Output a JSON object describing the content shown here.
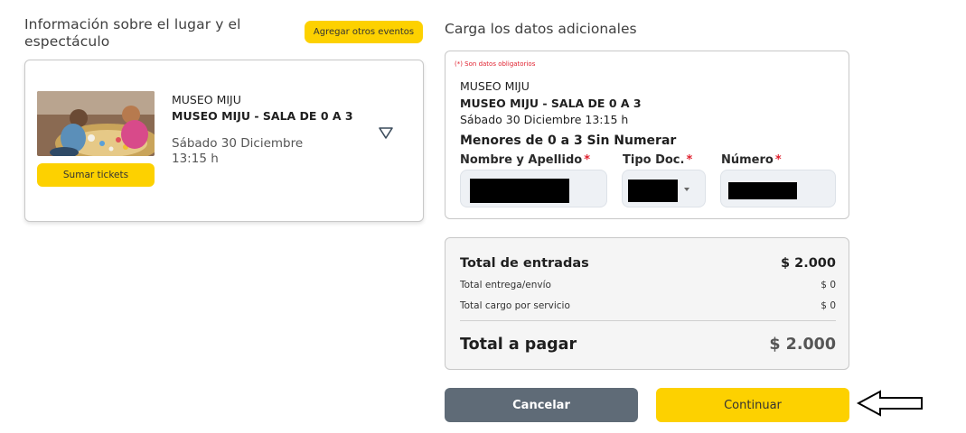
{
  "event_section": {
    "title": "Información sobre el lugar y el espectáculo",
    "other_events_button": "Agregar otros eventos",
    "event": {
      "venue": "MUSEO MIJU",
      "room": "MUSEO MIJU - SALA DE 0 A 3",
      "date": "Sábado 30 Diciembre",
      "time": "13:15 h",
      "add_tickets_button": "Sumar tickets"
    }
  },
  "additional_data": {
    "title": "Carga los datos adicionales",
    "required_note": "(*) Son datos obligatorios",
    "venue": "MUSEO MIJU",
    "room": "MUSEO MIJU - SALA DE 0 A 3",
    "datetime": "Sábado 30 Diciembre 13:15 h",
    "ticket_type": "Menores de 0 a 3 Sin Numerar",
    "fields": {
      "name_label": "Nombre y Apellido",
      "doc_type_label": "Tipo Doc.",
      "number_label": "Número",
      "required_mark": "*"
    }
  },
  "totals": {
    "entries_label": "Total de entradas",
    "entries_value": "$ 2.000",
    "shipping_label": "Total entrega/envío",
    "shipping_value": "$ 0",
    "service_label": "Total cargo por servicio",
    "service_value": "$ 0",
    "pay_label": "Total a pagar",
    "pay_value": "$ 2.000"
  },
  "actions": {
    "cancel": "Cancelar",
    "continue": "Continuar"
  },
  "colors": {
    "accent_yellow": "#fdd100",
    "cancel_gray": "#5f6b77",
    "required_red": "#e0212f"
  }
}
